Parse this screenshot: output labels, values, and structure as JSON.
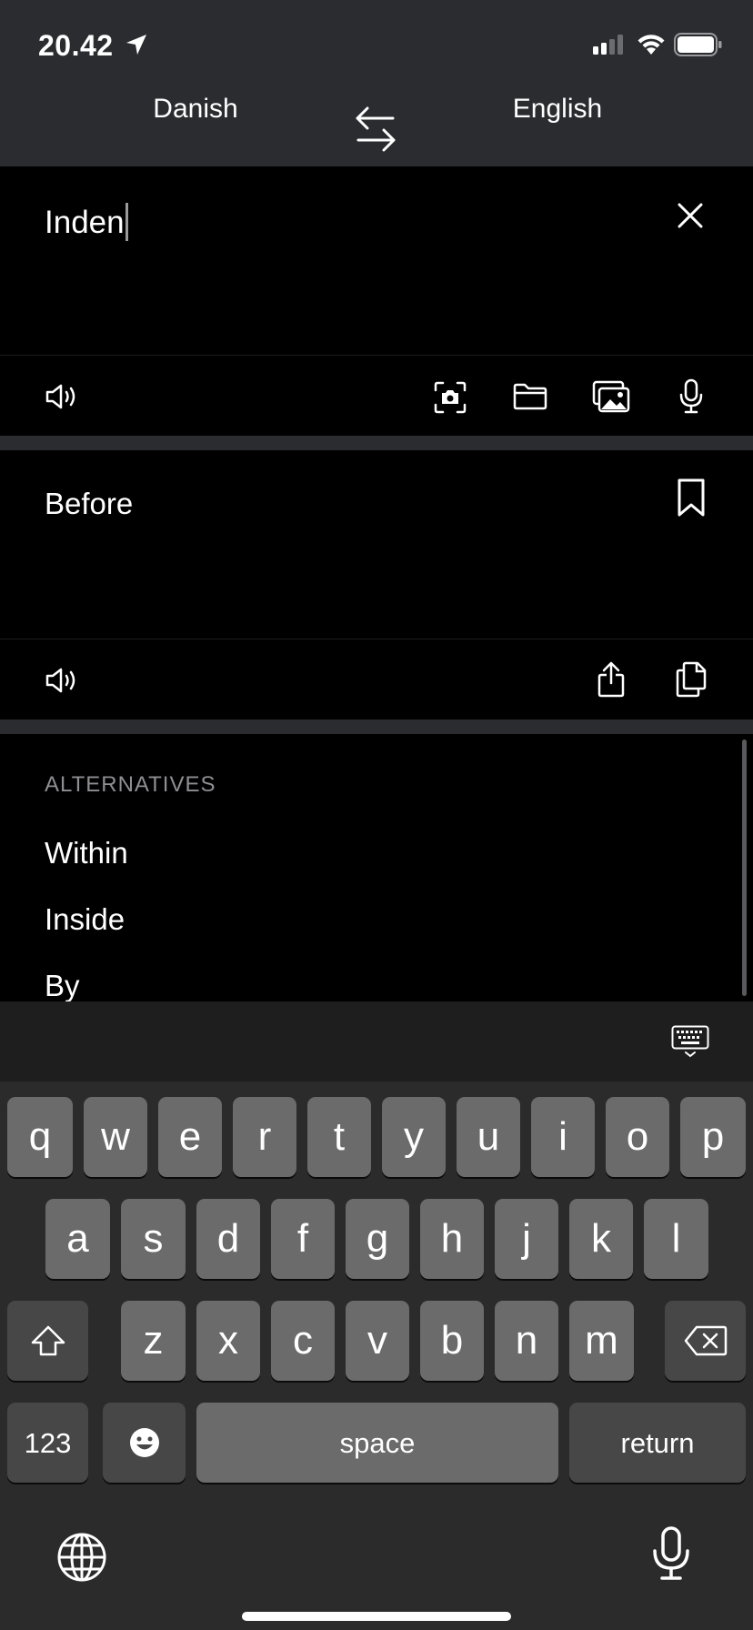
{
  "status_bar": {
    "time": "20.42"
  },
  "language_bar": {
    "source": "Danish",
    "target": "English"
  },
  "input": {
    "text": "Inden"
  },
  "output": {
    "text": "Before"
  },
  "alternatives": {
    "header": "ALTERNATIVES",
    "items": [
      "Within",
      "Inside",
      "By"
    ]
  },
  "keyboard": {
    "row1": [
      "q",
      "w",
      "e",
      "r",
      "t",
      "y",
      "u",
      "i",
      "o",
      "p"
    ],
    "row2": [
      "a",
      "s",
      "d",
      "f",
      "g",
      "h",
      "j",
      "k",
      "l"
    ],
    "row3": [
      "z",
      "x",
      "c",
      "v",
      "b",
      "n",
      "m"
    ],
    "numbers_key": "123",
    "space_key": "space",
    "return_key": "return"
  },
  "colors": {
    "chrome": "#2a2c30",
    "background": "#000000",
    "key": "#6b6b6b",
    "function_key": "#474747",
    "secondary_text": "#8e8e93"
  },
  "icons": [
    "location-arrow-icon",
    "signal-icon",
    "wifi-icon",
    "battery-icon",
    "swap-languages-icon",
    "clear-icon",
    "speaker-icon",
    "camera-scan-icon",
    "folder-icon",
    "images-icon",
    "microphone-icon",
    "bookmark-icon",
    "share-icon",
    "copy-icon",
    "keyboard-dismiss-icon",
    "shift-icon",
    "backspace-icon",
    "emoji-icon",
    "globe-icon",
    "dictation-icon"
  ]
}
